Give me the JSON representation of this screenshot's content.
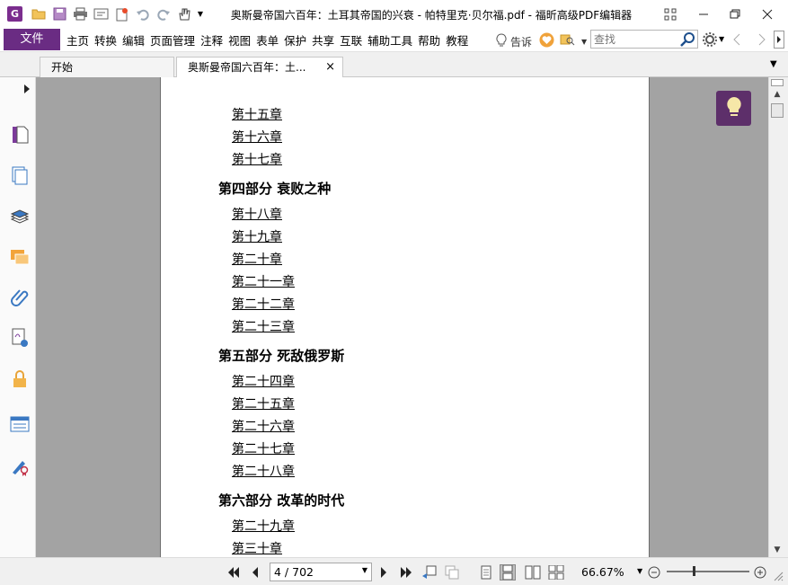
{
  "window": {
    "title": "奥斯曼帝国六百年：土耳其帝国的兴衰 - 帕特里克·贝尔福.pdf - 福昕高级PDF编辑器",
    "app_logo_letter": "G",
    "accent_color": "#6a2c83"
  },
  "menubar": {
    "file_label": "文件",
    "items": [
      "主页",
      "转换",
      "编辑",
      "页面管理",
      "注释",
      "视图",
      "表单",
      "保护",
      "共享",
      "互联",
      "辅助工具",
      "帮助",
      "教程"
    ],
    "tell_me_label": "告诉",
    "search_placeholder": "查找"
  },
  "tabs": [
    {
      "label": "开始"
    },
    {
      "label": "奥斯曼帝国六百年：土...",
      "close": "×"
    }
  ],
  "document": {
    "toc": [
      {
        "type": "chapter",
        "text": "第十五章"
      },
      {
        "type": "chapter",
        "text": "第十六章"
      },
      {
        "type": "chapter",
        "text": "第十七章"
      },
      {
        "type": "part",
        "text": "第四部分 衰败之种"
      },
      {
        "type": "chapter",
        "text": "第十八章"
      },
      {
        "type": "chapter",
        "text": "第十九章"
      },
      {
        "type": "chapter",
        "text": "第二十章"
      },
      {
        "type": "chapter",
        "text": "第二十一章"
      },
      {
        "type": "chapter",
        "text": "第二十二章"
      },
      {
        "type": "chapter",
        "text": "第二十三章"
      },
      {
        "type": "part",
        "text": "第五部分 死敌俄罗斯"
      },
      {
        "type": "chapter",
        "text": "第二十四章"
      },
      {
        "type": "chapter",
        "text": "第二十五章"
      },
      {
        "type": "chapter",
        "text": "第二十六章"
      },
      {
        "type": "chapter",
        "text": "第二十七章"
      },
      {
        "type": "chapter",
        "text": "第二十八章"
      },
      {
        "type": "part",
        "text": "第六部分 改革的时代"
      },
      {
        "type": "chapter",
        "text": "第二十九章"
      },
      {
        "type": "chapter",
        "text": "第三十章"
      }
    ]
  },
  "statusbar": {
    "page_value": "4 / 702",
    "zoom": "66.67%"
  }
}
